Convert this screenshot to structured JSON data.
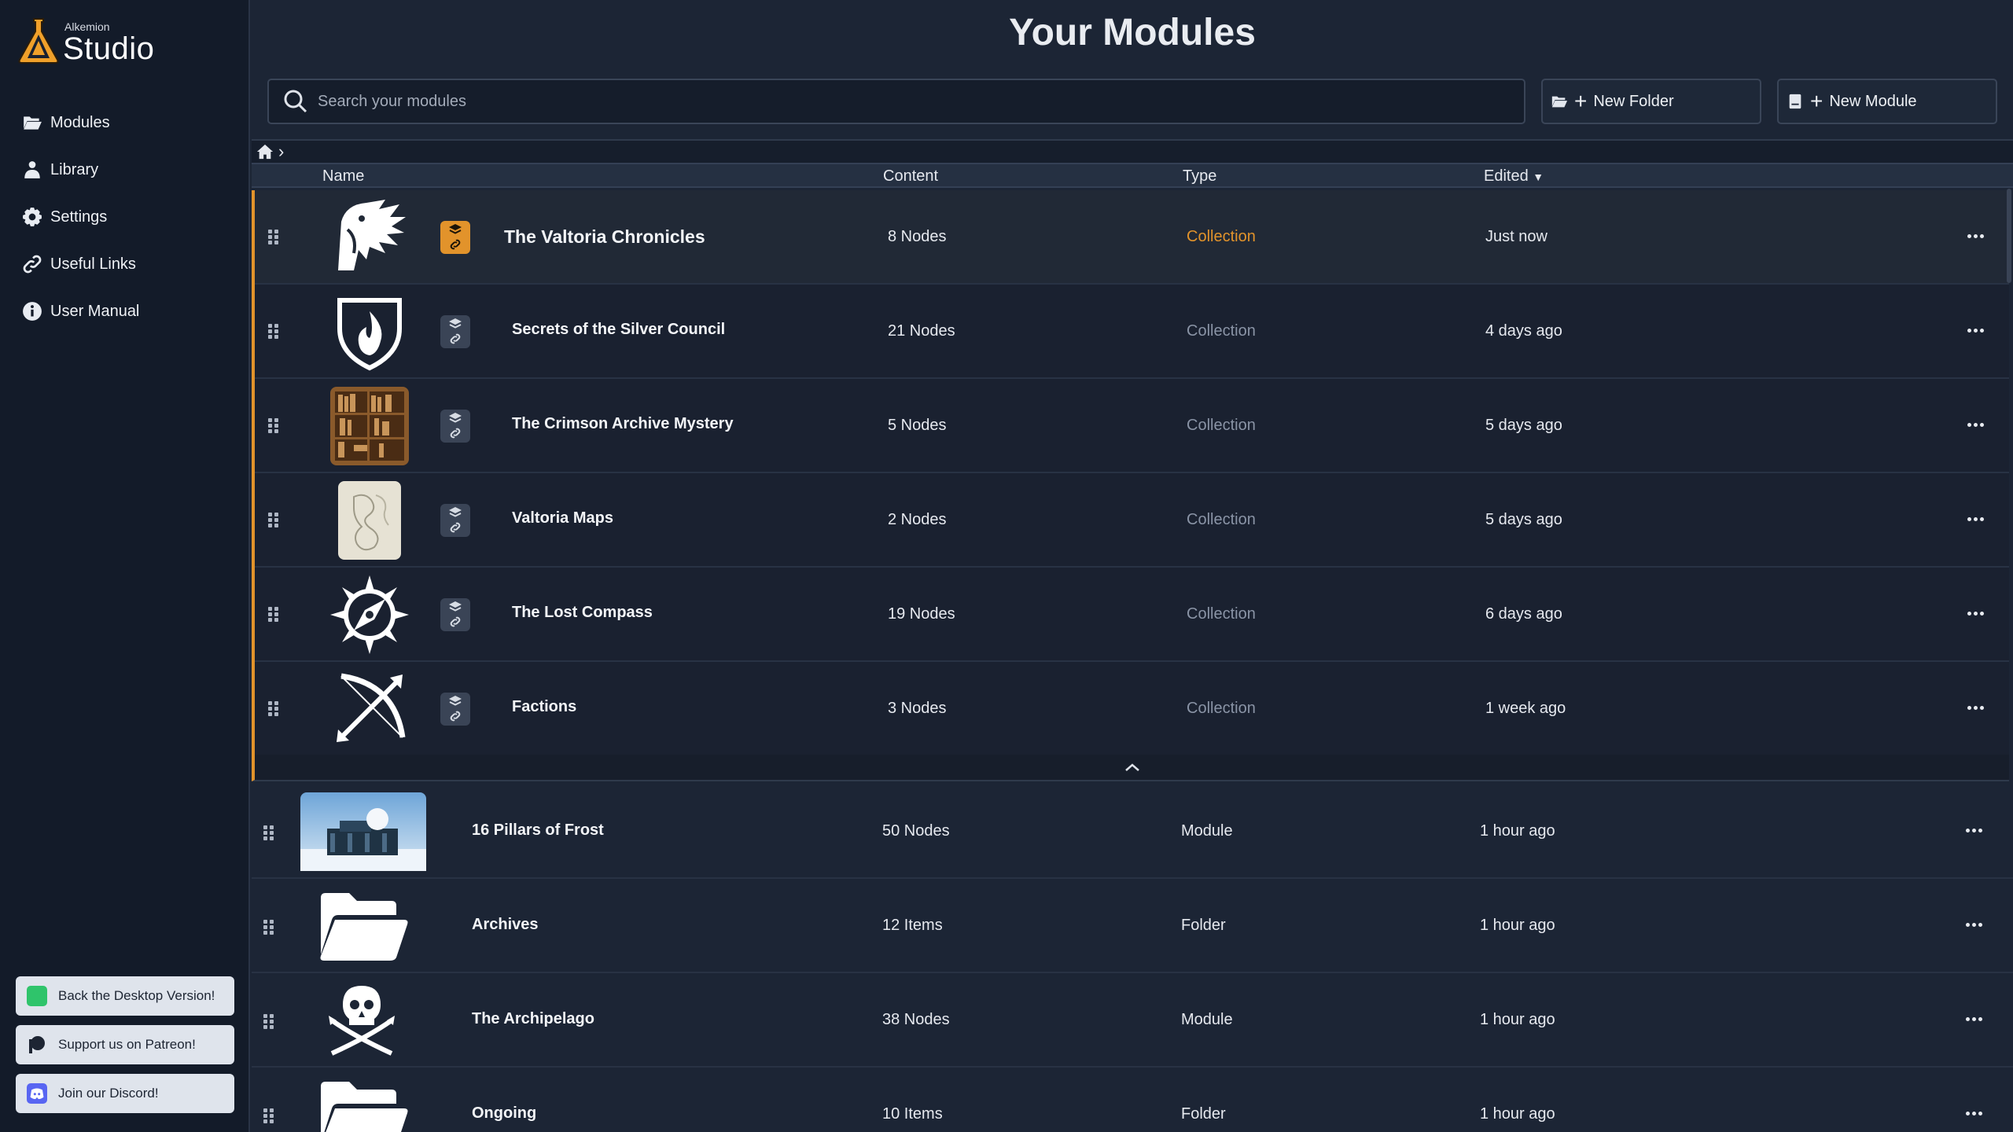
{
  "app": {
    "brand_small": "Alkemion",
    "brand_big": "Studio"
  },
  "sidebar": {
    "nav": [
      {
        "label": "Modules",
        "icon": "folder-icon"
      },
      {
        "label": "Library",
        "icon": "library-icon"
      },
      {
        "label": "Settings",
        "icon": "gear-icon"
      },
      {
        "label": "Useful Links",
        "icon": "link-icon"
      },
      {
        "label": "User Manual",
        "icon": "info-icon"
      }
    ],
    "buttons": {
      "desktop": "Back the Desktop Version!",
      "patreon": "Support us on Patreon!",
      "discord": "Join our Discord!"
    }
  },
  "header": {
    "title": "Your Modules",
    "search_placeholder": "Search your modules",
    "new_folder": "New Folder",
    "new_module": "New Module"
  },
  "columns": {
    "name": "Name",
    "content": "Content",
    "type": "Type",
    "edited": "Edited"
  },
  "accent": "#e2932b",
  "collection_items": [
    {
      "name": "The Valtoria Chronicles",
      "content": "8 Nodes",
      "type": "Collection",
      "edited": "Just now",
      "icon": "dragon-icon"
    },
    {
      "name": "Secrets of the Silver Council",
      "content": "21 Nodes",
      "type": "Collection",
      "edited": "4 days ago",
      "icon": "flame-shield-icon"
    },
    {
      "name": "The Crimson Archive Mystery",
      "content": "5 Nodes",
      "type": "Collection",
      "edited": "5 days ago",
      "icon": "bookshelf-image"
    },
    {
      "name": "Valtoria Maps",
      "content": "2 Nodes",
      "type": "Collection",
      "edited": "5 days ago",
      "icon": "map-image"
    },
    {
      "name": "The Lost Compass",
      "content": "19 Nodes",
      "type": "Collection",
      "edited": "6 days ago",
      "icon": "compass-icon"
    },
    {
      "name": "Factions",
      "content": "3 Nodes",
      "type": "Collection",
      "edited": "1 week ago",
      "icon": "bow-arrow-icon"
    }
  ],
  "items": [
    {
      "name": "16 Pillars of Frost",
      "content": "50 Nodes",
      "type": "Module",
      "edited": "1 hour ago",
      "icon": "frost-building-image"
    },
    {
      "name": "Archives",
      "content": "12 Items",
      "type": "Folder",
      "edited": "1 hour ago",
      "icon": "folder-open-icon"
    },
    {
      "name": "The Archipelago",
      "content": "38 Nodes",
      "type": "Module",
      "edited": "1 hour ago",
      "icon": "skull-crossbones-icon"
    },
    {
      "name": "Ongoing",
      "content": "10 Items",
      "type": "Folder",
      "edited": "1 hour ago",
      "icon": "folder-open-icon"
    }
  ]
}
